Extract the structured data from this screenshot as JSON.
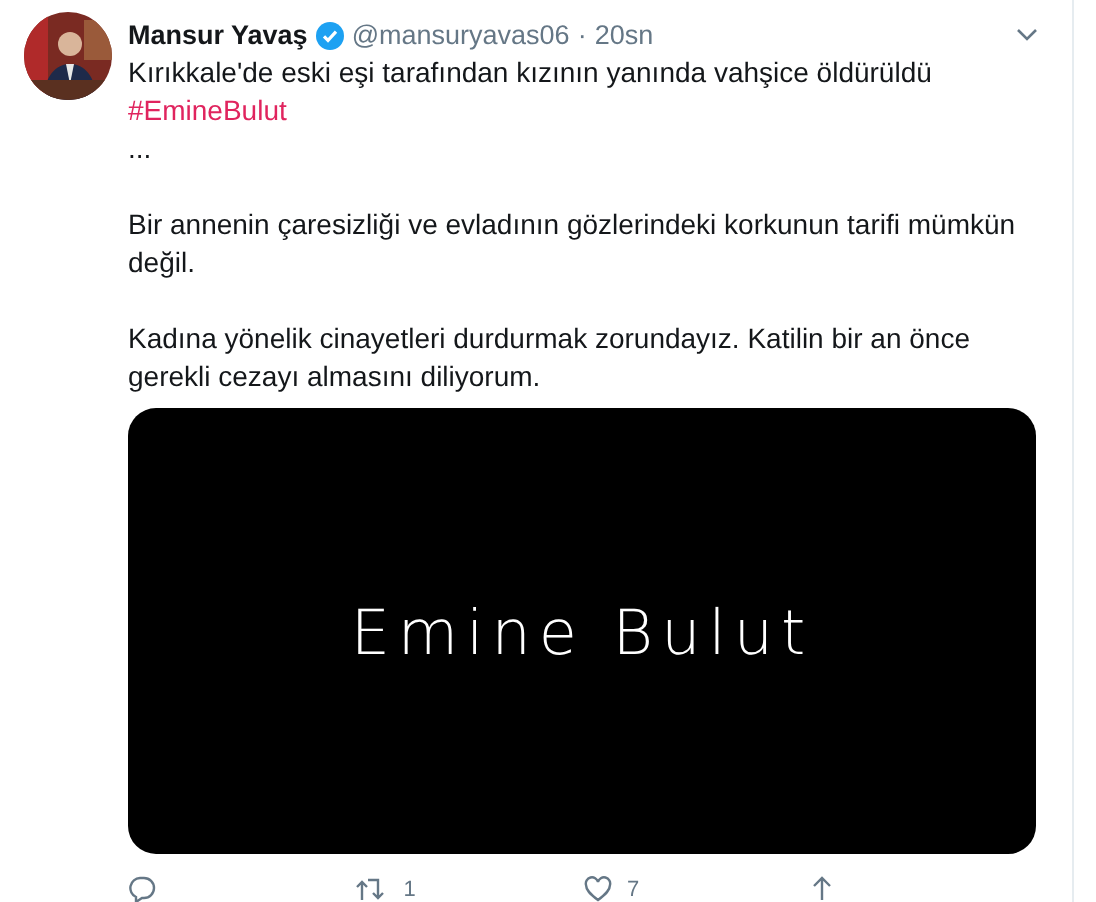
{
  "tweet": {
    "author": {
      "name": "Mansur Yavaş",
      "verified": true,
      "handle": "@mansuryavas06",
      "separator": "·",
      "time": "20sn"
    },
    "paragraphs": [
      "Kırıkkale'de eski eşi tarafından kızının yanında vahşice öldürüldü ",
      "Bir annenin çaresizliği ve evladının gözlerindeki korkunun tarifi mümkün değil.",
      "Kadına yönelik cinayetleri durdurmak zorundayız. Katilin bir an önce gerekli cezayı almasını diliyorum."
    ],
    "hashtag": "#EmineBulut",
    "ellipsis": "...",
    "media": {
      "text": "Emine Bulut"
    },
    "actions": [
      {
        "kind": "reply"
      },
      {
        "kind": "retweet",
        "count": "1"
      },
      {
        "kind": "like",
        "count": "7"
      },
      {
        "kind": "share"
      }
    ]
  }
}
